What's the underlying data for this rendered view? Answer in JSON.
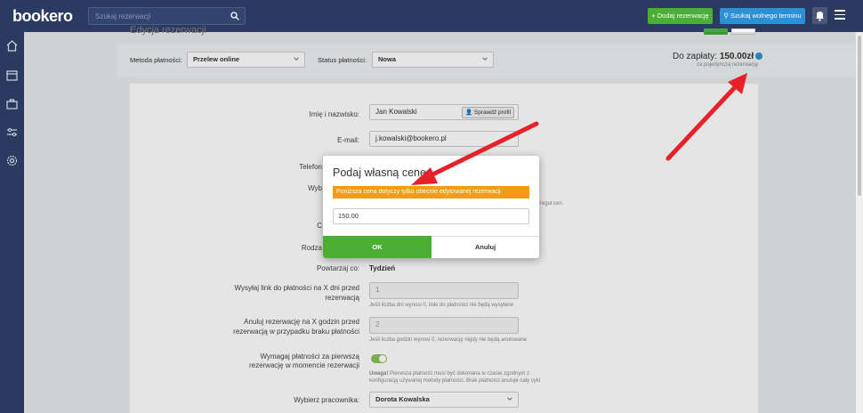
{
  "app": {
    "logo_text": "bookero"
  },
  "topbar": {
    "search_placeholder": "Szukaj rezerwacji",
    "add_reservation": "+ Dodaj rezerwację",
    "find_free_slot": "Szukaj wolnego terminu"
  },
  "page": {
    "title": "Edycja rezerwacji"
  },
  "filters": {
    "payment_method_label": "Metoda płatności:",
    "payment_method_value": "Przelew online",
    "payment_status_label": "Status płatności:",
    "payment_status_value": "Nowa"
  },
  "payment": {
    "label": "Do zapłaty:",
    "amount": "150.00zł",
    "sub": "za pojedynczą rezerwację"
  },
  "form": {
    "name_label": "Imię i nazwisko:",
    "name_value": "Jan Kowalski",
    "check_profile": "Sprawdź profil",
    "email_label": "E-mail:",
    "email_value": "j.kowalski@bookero.pl",
    "phone_label": "Telefon",
    "partial_label_1": "Wyb",
    "partial_label_2": "C",
    "partial_label_3": "Rodza",
    "partial_hint": "reguł cen.",
    "repeat_label": "Powtarzaj co:",
    "repeat_value": "Tydzień",
    "send_link_label": "Wysyłaj link do płatności na X dni przed rezerwacją",
    "send_link_value": "1",
    "send_link_hint": "Jeśli liczba dni wynosi 0, linki do płatności nie będą wysyłane",
    "cancel_label": "Anuluj rezerwację na X godzin przed rezerwacją w przypadku braku płatności",
    "cancel_value": "2",
    "cancel_hint": "Jeśli liczba godzin wynosi 0, rezerwację nigdy nie będą anulowane",
    "require_label": "Wymagaj płatności za pierwszą rezerwację w momencie rezerwacji",
    "require_hint_bold": "Uwaga!",
    "require_hint": "Pierwsza płatność musi być dokonana w czasie zgodnym z konfiguracją używanej metody płatności. Brak płatności anuluje cały cykl.",
    "employee_label": "Wybierz pracownika:",
    "employee_value": "Dorota Kowalska"
  },
  "modal": {
    "title": "Podaj własną cenę",
    "warning": "Poniższa cena dotyczy tylko obecnie edytowanej rezerwacji",
    "price_value": "150.00",
    "ok": "OK",
    "cancel": "Anuluj"
  },
  "colors": {
    "topbar": "#2b3a60",
    "green": "#4caf35",
    "blue": "#2d8fd6",
    "warning": "#f39c12",
    "arrow": "#e8202a"
  },
  "icons": {
    "sidebar": [
      "home-icon",
      "calendar-icon",
      "briefcase-icon",
      "sliders-icon",
      "gear-icon"
    ]
  }
}
